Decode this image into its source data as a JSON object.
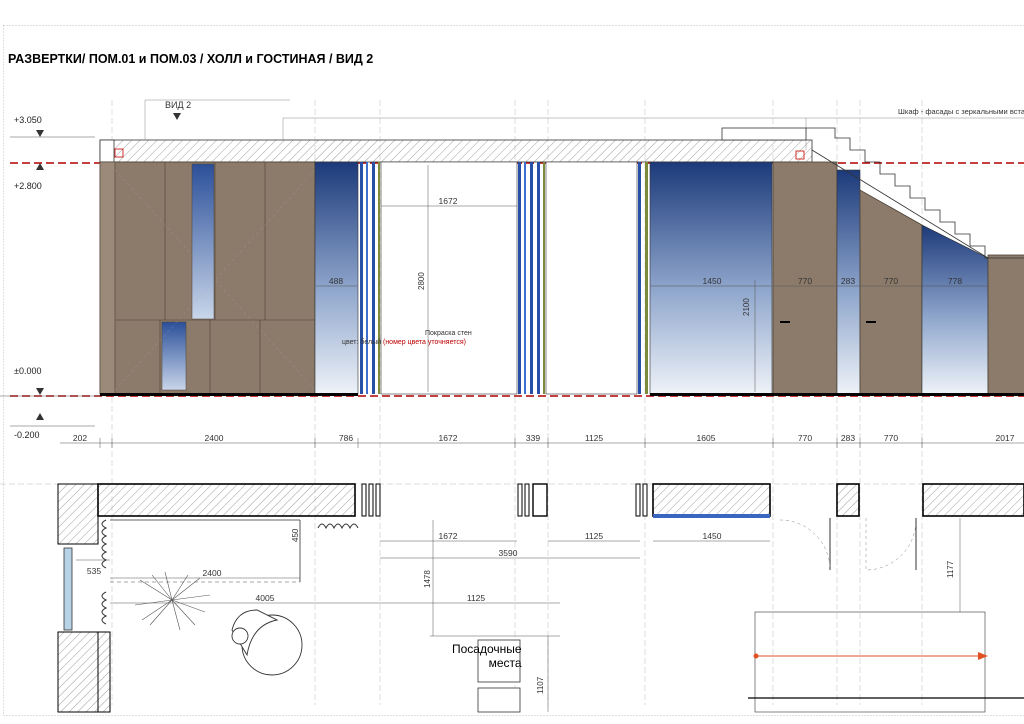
{
  "title": "РАЗВЕРТКИ/ ПОМ.01 и ПОМ.03 / ХОЛЛ и ГОСТИНАЯ  / ВИД 2",
  "view_label": "ВИД 2",
  "cabinet_note": "Шкаф - фасады с зеркальными вставкам",
  "levels": [
    "+3.050",
    "+2.800",
    "±0.000",
    "-0.200"
  ],
  "paint_note": {
    "line1": "Покраска стен",
    "line2_prefix": "цвет: белый",
    "line2_red": "(номер цвета уточняется)"
  },
  "elevation_dims": [
    "202",
    "2400",
    "786",
    "1672",
    "339",
    "1125",
    "1605",
    "770",
    "283",
    "770",
    "2017"
  ],
  "inner_dims": {
    "d488": "488",
    "d1672": "1672",
    "d2800": "2800",
    "d1450": "1450",
    "d2100": "2100",
    "d770a": "770",
    "d283": "283",
    "d770b": "770",
    "d778": "778"
  },
  "plan_dims": {
    "p450": "450",
    "p1672": "1672",
    "p1125a": "1125",
    "p1450": "1450",
    "p3590": "3590",
    "p535": "535",
    "p2400": "2400",
    "p1478": "1478",
    "p4005": "4005",
    "p1125b": "1125",
    "p1177": "1177",
    "p1107": "1107"
  },
  "seating_label_1": "Посадочные",
  "seating_label_2": "места",
  "colors": {
    "panel": "#8c7b6b",
    "glass_dark": "#1c3a7a",
    "glass_light": "#dfe8f3",
    "level_red": "#b00000",
    "arrow": "#e05020"
  }
}
